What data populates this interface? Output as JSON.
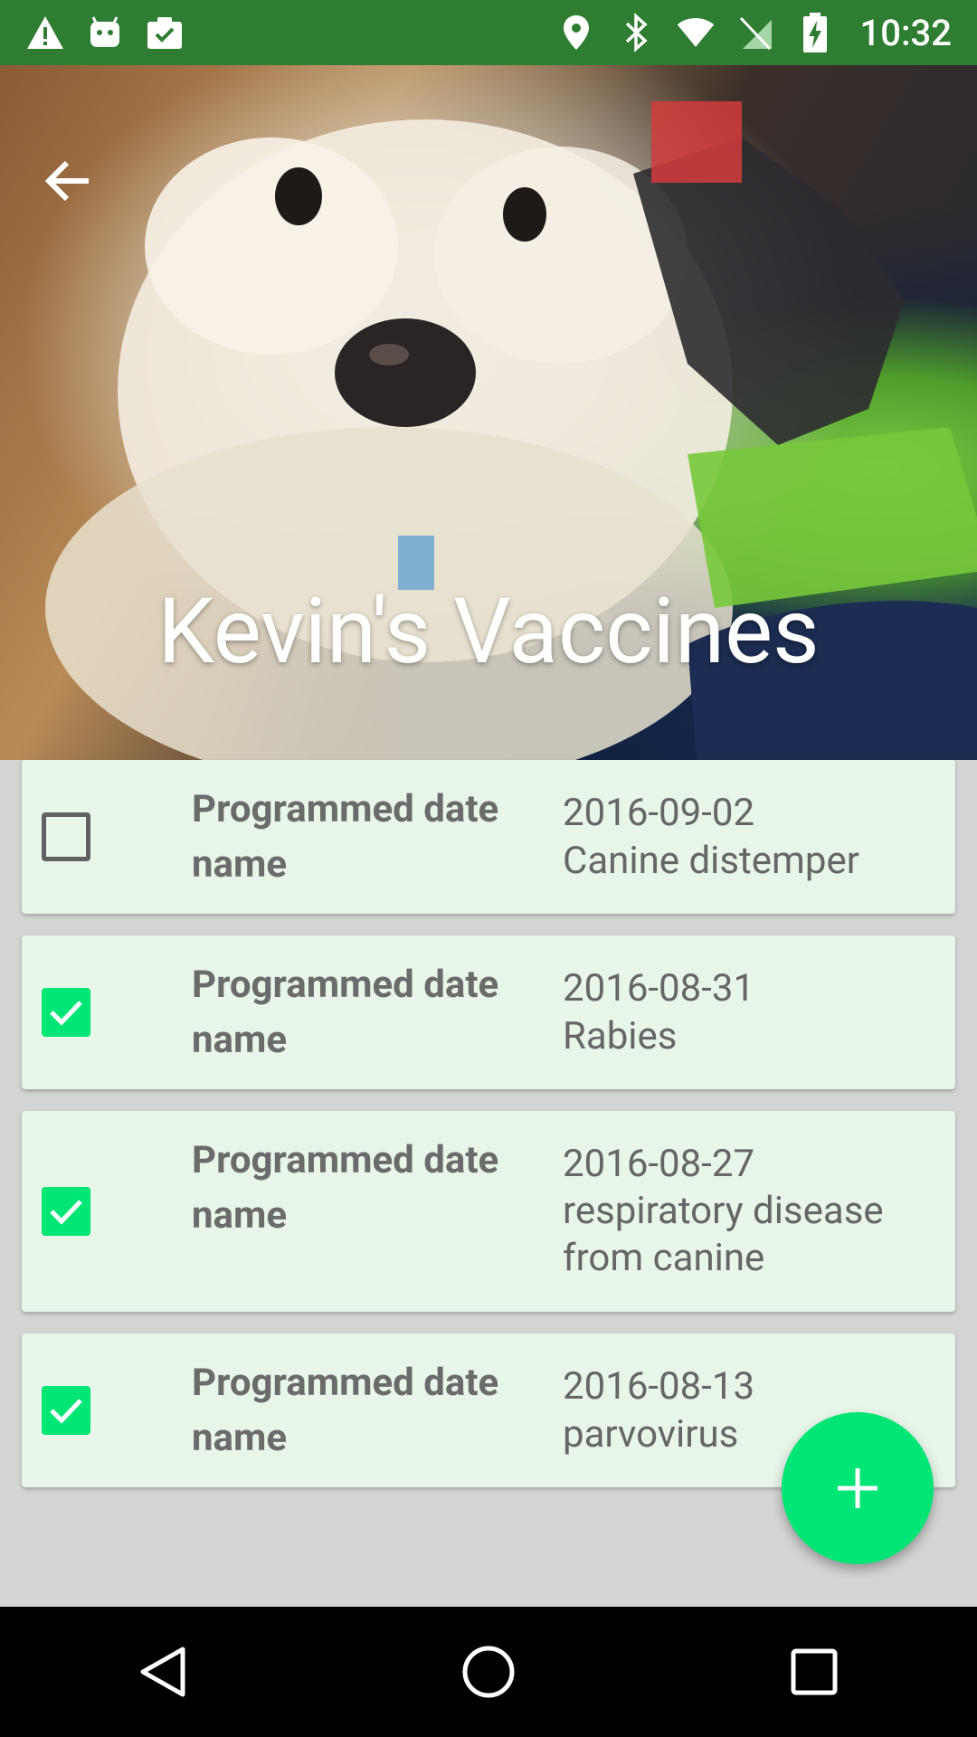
{
  "status_bar": {
    "time": "10:32",
    "icons": [
      "warning-icon",
      "android-icon",
      "clipboard-check-icon",
      "location-icon",
      "bluetooth-icon",
      "wifi-icon",
      "no-sim-icon",
      "battery-charging-icon"
    ],
    "background": "#2e7d32"
  },
  "header": {
    "title": "Kevin's Vaccines",
    "back_icon": "arrow-back-icon"
  },
  "vaccines": [
    {
      "checked": false,
      "label_date": "Programmed date",
      "label_name": "name",
      "date": "2016-09-02",
      "name": "Canine distemper"
    },
    {
      "checked": true,
      "label_date": "Programmed date",
      "label_name": "name",
      "date": "2016-08-31",
      "name": "Rabies"
    },
    {
      "checked": true,
      "label_date": "Programmed date",
      "label_name": "name",
      "date": "2016-08-27",
      "name": "respiratory disease from canine"
    },
    {
      "checked": true,
      "label_date": "Programmed date",
      "label_name": "name",
      "date": "2016-08-13",
      "name": "parvovirus"
    }
  ],
  "fab": {
    "icon": "plus-icon",
    "color": "#00e676"
  },
  "nav_bar": {
    "icons": [
      "back-triangle-icon",
      "home-circle-icon",
      "recents-square-icon"
    ]
  },
  "colors": {
    "card": "#e8f5e9",
    "accent": "#00e676",
    "background": "#d4d4d4"
  }
}
